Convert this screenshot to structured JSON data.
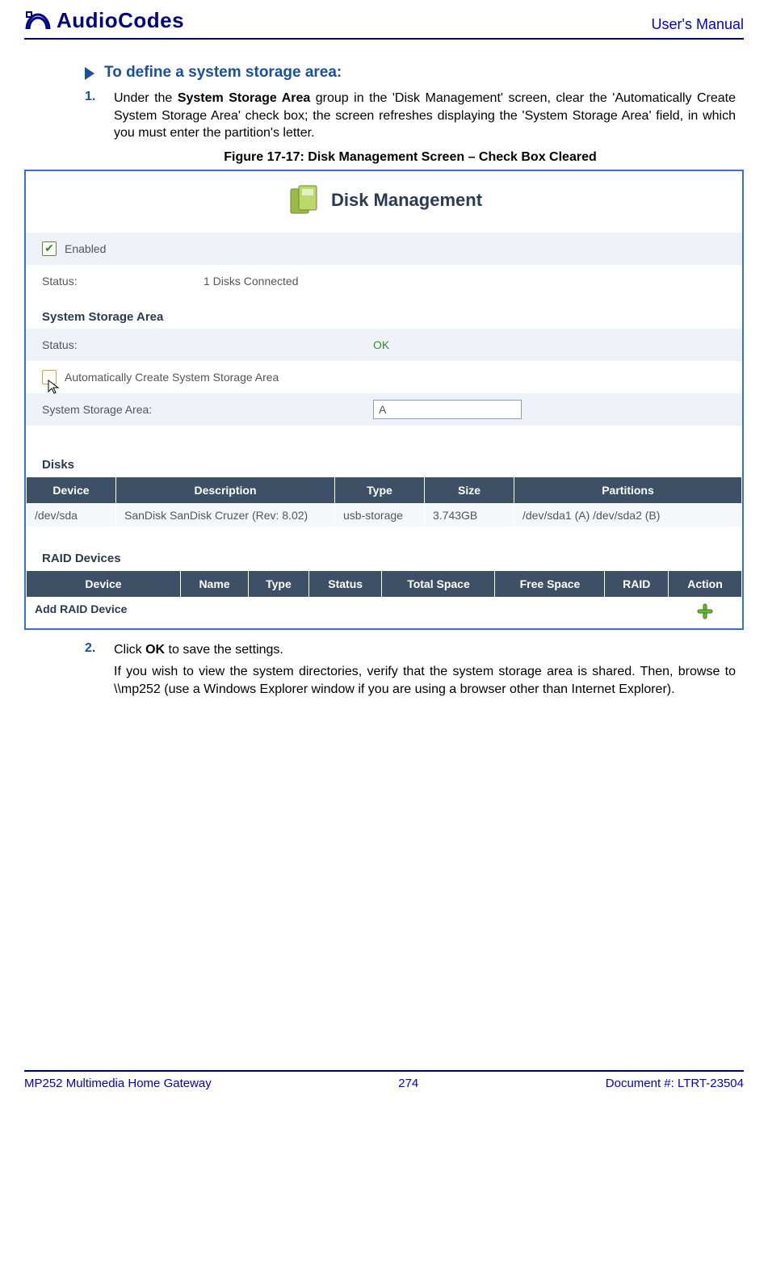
{
  "header": {
    "logo_text": "AudioCodes",
    "right": "User's Manual"
  },
  "section": {
    "heading": "To define a system storage area:",
    "step1_num": "1.",
    "step1_pre": "Under the ",
    "step1_bold": "System Storage Area",
    "step1_post": " group in the 'Disk Management' screen, clear the 'Automatically Create System Storage Area' check box; the screen refreshes displaying the 'System Storage Area' field, in which you must enter the partition's letter.",
    "fig_caption": "Figure 17-17: Disk Management Screen – Check Box Cleared",
    "step2_num": "2.",
    "step2_pre": "Click ",
    "step2_bold": "OK",
    "step2_post": " to save the settings.",
    "note": "If you wish to view the system directories, verify that the system storage area is shared. Then, browse to \\\\mp252 (use a Windows Explorer window if you are using a browser other than Internet Explorer)."
  },
  "dm": {
    "title": "Disk Management",
    "enabled_label": "Enabled",
    "status_label": "Status:",
    "status_value": "1 Disks Connected",
    "ssa_heading": "System Storage Area",
    "ssa_status_label": "Status:",
    "ssa_status_value": "OK",
    "auto_create_label": "Automatically Create System Storage Area",
    "ssa_field_label": "System Storage Area:",
    "ssa_field_value": "A",
    "disks_heading": "Disks",
    "disks_headers": [
      "Device",
      "Description",
      "Type",
      "Size",
      "Partitions"
    ],
    "disks_row": {
      "device": "/dev/sda",
      "description": "SanDisk SanDisk Cruzer (Rev: 8.02)",
      "type": "usb-storage",
      "size": "3.743GB",
      "partitions": "/dev/sda1 (A) /dev/sda2 (B)"
    },
    "raid_heading": "RAID Devices",
    "raid_headers": [
      "Device",
      "Name",
      "Type",
      "Status",
      "Total Space",
      "Free Space",
      "RAID",
      "Action"
    ],
    "raid_add_label": "Add RAID Device"
  },
  "footer": {
    "left": "MP252 Multimedia Home Gateway",
    "center": "274",
    "right": "Document #: LTRT-23504"
  }
}
